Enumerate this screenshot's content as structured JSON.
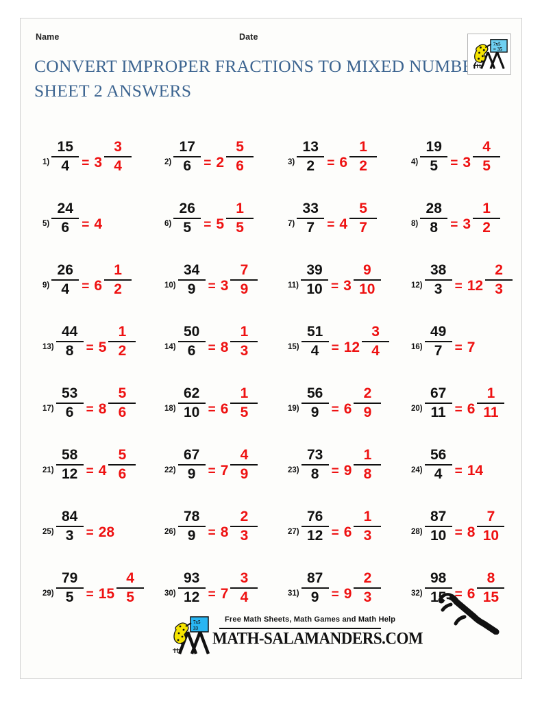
{
  "header": {
    "name_label": "Name",
    "date_label": "Date",
    "title_line1": "CONVERT IMPROPER FRACTIONS TO MIXED NUMBERS",
    "title_line2": "SHEET 2 ANSWERS",
    "title_color": "#3c6490",
    "logo": {
      "icon": "salamander-blackboard-icon",
      "board_line1": "7x5",
      "board_line2": "= 35"
    }
  },
  "answer_color": "#ee1111",
  "problem_color": "#111111",
  "problems": [
    {
      "num": "1)",
      "n": "15",
      "d": "4",
      "eq": "=",
      "whole": "3",
      "an": "3",
      "ad": "4"
    },
    {
      "num": "2)",
      "n": "17",
      "d": "6",
      "eq": "=",
      "whole": "2",
      "an": "5",
      "ad": "6"
    },
    {
      "num": "3)",
      "n": "13",
      "d": "2",
      "eq": "=",
      "whole": "6",
      "an": "1",
      "ad": "2"
    },
    {
      "num": "4)",
      "n": "19",
      "d": "5",
      "eq": "=",
      "whole": "3",
      "an": "4",
      "ad": "5"
    },
    {
      "num": "5)",
      "n": "24",
      "d": "6",
      "eq": "=",
      "whole": "4",
      "an": "",
      "ad": ""
    },
    {
      "num": "6)",
      "n": "26",
      "d": "5",
      "eq": "=",
      "whole": "5",
      "an": "1",
      "ad": "5"
    },
    {
      "num": "7)",
      "n": "33",
      "d": "7",
      "eq": "=",
      "whole": "4",
      "an": "5",
      "ad": "7"
    },
    {
      "num": "8)",
      "n": "28",
      "d": "8",
      "eq": "=",
      "whole": "3",
      "an": "1",
      "ad": "2"
    },
    {
      "num": "9)",
      "n": "26",
      "d": "4",
      "eq": "=",
      "whole": "6",
      "an": "1",
      "ad": "2"
    },
    {
      "num": "10)",
      "n": "34",
      "d": "9",
      "eq": "=",
      "whole": "3",
      "an": "7",
      "ad": "9"
    },
    {
      "num": "11)",
      "n": "39",
      "d": "10",
      "eq": "=",
      "whole": "3",
      "an": "9",
      "ad": "10"
    },
    {
      "num": "12)",
      "n": "38",
      "d": "3",
      "eq": "=",
      "whole": "12",
      "an": "2",
      "ad": "3"
    },
    {
      "num": "13)",
      "n": "44",
      "d": "8",
      "eq": "=",
      "whole": "5",
      "an": "1",
      "ad": "2"
    },
    {
      "num": "14)",
      "n": "50",
      "d": "6",
      "eq": "=",
      "whole": "8",
      "an": "1",
      "ad": "3"
    },
    {
      "num": "15)",
      "n": "51",
      "d": "4",
      "eq": "=",
      "whole": "12",
      "an": "3",
      "ad": "4"
    },
    {
      "num": "16)",
      "n": "49",
      "d": "7",
      "eq": "=",
      "whole": "7",
      "an": "",
      "ad": ""
    },
    {
      "num": "17)",
      "n": "53",
      "d": "6",
      "eq": "=",
      "whole": "8",
      "an": "5",
      "ad": "6"
    },
    {
      "num": "18)",
      "n": "62",
      "d": "10",
      "eq": "=",
      "whole": "6",
      "an": "1",
      "ad": "5"
    },
    {
      "num": "19)",
      "n": "56",
      "d": "9",
      "eq": "=",
      "whole": "6",
      "an": "2",
      "ad": "9"
    },
    {
      "num": "20)",
      "n": "67",
      "d": "11",
      "eq": "=",
      "whole": "6",
      "an": "1",
      "ad": "11"
    },
    {
      "num": "21)",
      "n": "58",
      "d": "12",
      "eq": "=",
      "whole": "4",
      "an": "5",
      "ad": "6"
    },
    {
      "num": "22)",
      "n": "67",
      "d": "9",
      "eq": "=",
      "whole": "7",
      "an": "4",
      "ad": "9"
    },
    {
      "num": "23)",
      "n": "73",
      "d": "8",
      "eq": "=",
      "whole": "9",
      "an": "1",
      "ad": "8"
    },
    {
      "num": "24)",
      "n": "56",
      "d": "4",
      "eq": "=",
      "whole": "14",
      "an": "",
      "ad": ""
    },
    {
      "num": "25)",
      "n": "84",
      "d": "3",
      "eq": "=",
      "whole": "28",
      "an": "",
      "ad": ""
    },
    {
      "num": "26)",
      "n": "78",
      "d": "9",
      "eq": "=",
      "whole": "8",
      "an": "2",
      "ad": "3"
    },
    {
      "num": "27)",
      "n": "76",
      "d": "12",
      "eq": "=",
      "whole": "6",
      "an": "1",
      "ad": "3"
    },
    {
      "num": "28)",
      "n": "87",
      "d": "10",
      "eq": "=",
      "whole": "8",
      "an": "7",
      "ad": "10"
    },
    {
      "num": "29)",
      "n": "79",
      "d": "5",
      "eq": "=",
      "whole": "15",
      "an": "4",
      "ad": "5"
    },
    {
      "num": "30)",
      "n": "93",
      "d": "12",
      "eq": "=",
      "whole": "7",
      "an": "3",
      "ad": "4"
    },
    {
      "num": "31)",
      "n": "87",
      "d": "9",
      "eq": "=",
      "whole": "9",
      "an": "2",
      "ad": "3"
    },
    {
      "num": "32)",
      "n": "98",
      "d": "15",
      "eq": "=",
      "whole": "6",
      "an": "8",
      "ad": "15"
    }
  ],
  "footer": {
    "tagline": "Free Math Sheets, Math Games and Math Help",
    "url": "MATH-SALAMANDERS.COM",
    "logo_icon": "salamander-blackboard-icon",
    "deco_icon": "salamander-icon"
  }
}
